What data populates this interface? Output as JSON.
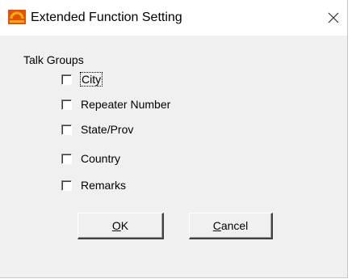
{
  "window": {
    "title": "Extended Function Setting",
    "close_label": "×"
  },
  "talk_groups": {
    "label": "Talk Groups",
    "options": [
      {
        "label": "City",
        "checked": false,
        "focused": true
      },
      {
        "label": "Repeater Number",
        "checked": false,
        "focused": false
      },
      {
        "label": "State/Prov",
        "checked": false,
        "focused": false
      },
      {
        "label": "Country",
        "checked": false,
        "focused": false
      },
      {
        "label": "Remarks",
        "checked": false,
        "focused": false
      }
    ]
  },
  "buttons": {
    "ok": {
      "mnemonic": "O",
      "rest": "K"
    },
    "cancel": {
      "mnemonic": "C",
      "rest": "ancel"
    }
  },
  "colors": {
    "dialog_bg": "#f0f0f0",
    "titlebar_bg": "#ffffff",
    "icon_primary": "#e8500a",
    "icon_secondary": "#f5b800"
  },
  "icons": {
    "app": "app-logo-icon",
    "close": "close-icon"
  }
}
